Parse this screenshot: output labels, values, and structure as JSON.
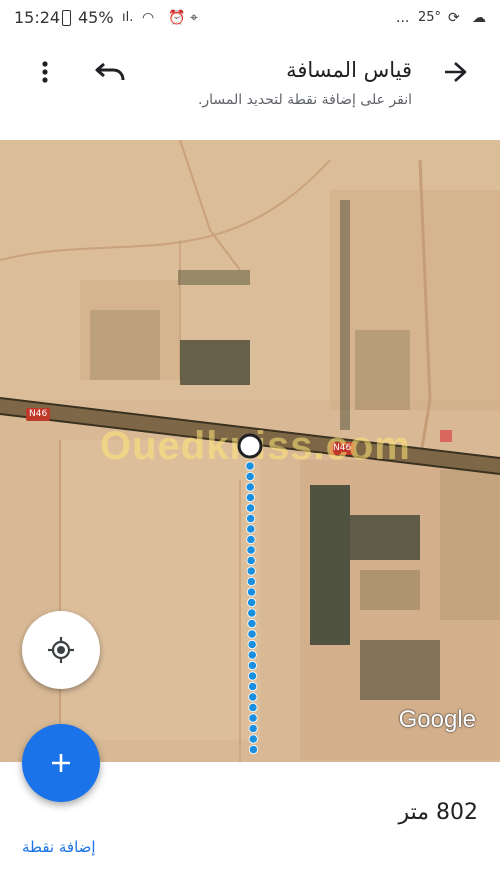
{
  "status_bar": {
    "time": "15:24",
    "battery": "45%",
    "temperature": "25°",
    "dots": "..."
  },
  "header": {
    "title": "قياس المسافة",
    "subtitle": "انقر على إضافة نقطة لتحديد المسار.",
    "back_icon": "arrow-back-icon",
    "undo_icon": "undo-icon",
    "menu_icon": "more-vert-icon"
  },
  "map": {
    "road_label": "N46",
    "watermark": "Ouedkniss.com",
    "attribution": "Google",
    "path_color": "#1a8fe0"
  },
  "controls": {
    "locate_icon": "my-location-icon",
    "add_icon": "add-icon",
    "add_color": "#1a73e8"
  },
  "bottom_panel": {
    "distance": "802 متر",
    "add_point_label": "إضافة نقطة"
  }
}
